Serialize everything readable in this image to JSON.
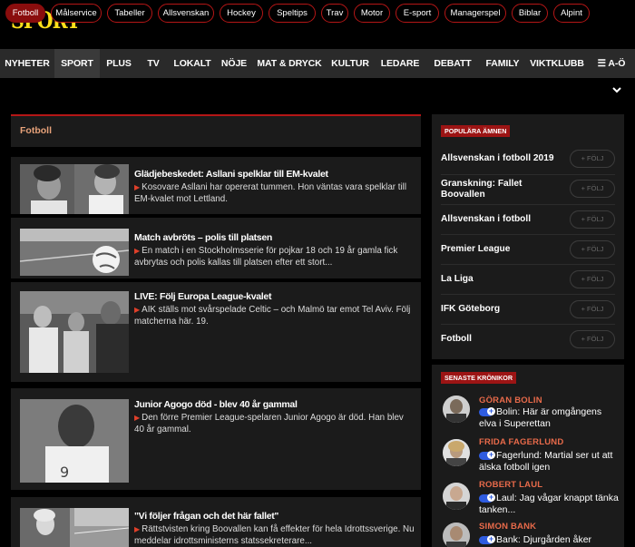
{
  "brand": {
    "logo": "SPORT",
    "logo_color": "#ffe01a",
    "accent": "#b51616"
  },
  "main_nav": [
    "NYHETER",
    "SPORT",
    "PLUS",
    "TV",
    "LOKALT",
    "NÖJE",
    "MAT & DRYCK",
    "KULTUR",
    "LEDARE",
    "DEBATT",
    "FAMILY",
    "VIKTKLUBB",
    "A-Ö"
  ],
  "main_nav_active": "SPORT",
  "sub_nav": [
    "Fotboll",
    "Målservice",
    "Tabeller",
    "Allsvenskan",
    "Hockey",
    "Speltips",
    "Trav",
    "Motor",
    "E-sport",
    "Managerspel",
    "Biblar",
    "Alpint"
  ],
  "sub_nav_active": "Fotboll",
  "section": {
    "title": "Fotboll"
  },
  "articles": [
    {
      "title": "Glädjebeskedet: Asllani spelklar till EM-kvalet",
      "desc": "Kosovare Asllani har opererat tummen. Hon väntas vara spelklar till EM-kvalet mot Lettland."
    },
    {
      "title": "Match avbröts – polis till platsen",
      "desc": "En match i en Stockholmsserie för pojkar 18 och 19 år gamla fick avbrytas och polis kallas till platsen efter ett stort..."
    },
    {
      "title": "LIVE: Följ Europa League-kvalet",
      "desc": "AIK ställs mot svårspelade Celtic – och Malmö tar emot Tel Aviv. Följ matcherna här. 19."
    },
    {
      "title": "Junior Agogo död - blev 40 år gammal",
      "desc": "Den förre Premier League-spelaren Junior Agogo är död. Han blev 40 år gammal."
    },
    {
      "title": "\"Vi följer frågan och det här fallet\"",
      "desc": "Rättstvisten kring Boovallen kan få effekter för hela Idrottssverige. Nu meddelar idrottsministerns statssekreterare..."
    }
  ],
  "popular": {
    "label": "POPULÄRA ÄMNEN",
    "follow_label": "+ FÖLJ",
    "topics": [
      "Allsvenskan i fotboll 2019",
      "Granskning: Fallet Boovallen",
      "Allsvenskan i fotboll",
      "Premier League",
      "La Liga",
      "IFK Göteborg",
      "Fotboll"
    ]
  },
  "columns": {
    "label": "SENASTE KRÖNIKOR",
    "items": [
      {
        "name": "GÖRAN BOLIN",
        "text": "Bolin: Här är omgångens elva i Superettan"
      },
      {
        "name": "FRIDA FAGERLUND",
        "text": "Fagerlund: Martial ser ut att älska fotboll igen"
      },
      {
        "name": "ROBERT LAUL",
        "text": "Laul: Jag vågar knappt tänka tanken..."
      },
      {
        "name": "SIMON BANK",
        "text": "Bank: Djurgården åker"
      }
    ]
  }
}
